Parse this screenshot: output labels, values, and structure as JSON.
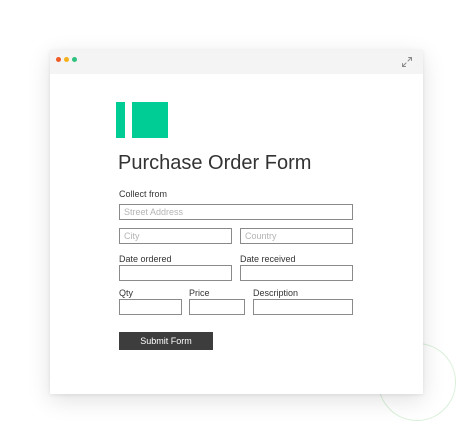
{
  "colors": {
    "dot_red": "#ef5b25",
    "dot_yellow": "#f5b11b",
    "dot_green": "#2ec27e",
    "accent": "#00cc96"
  },
  "window": {
    "expand_icon": "expand-arrows-icon"
  },
  "form": {
    "title": "Purchase Order Form",
    "collect_from_label": "Collect from",
    "street_placeholder": "Street Address",
    "city_placeholder": "City",
    "country_placeholder": "Country",
    "date_ordered_label": "Date ordered",
    "date_received_label": "Date received",
    "qty_label": "Qty",
    "price_label": "Price",
    "description_label": "Description",
    "submit_label": "Submit Form"
  }
}
